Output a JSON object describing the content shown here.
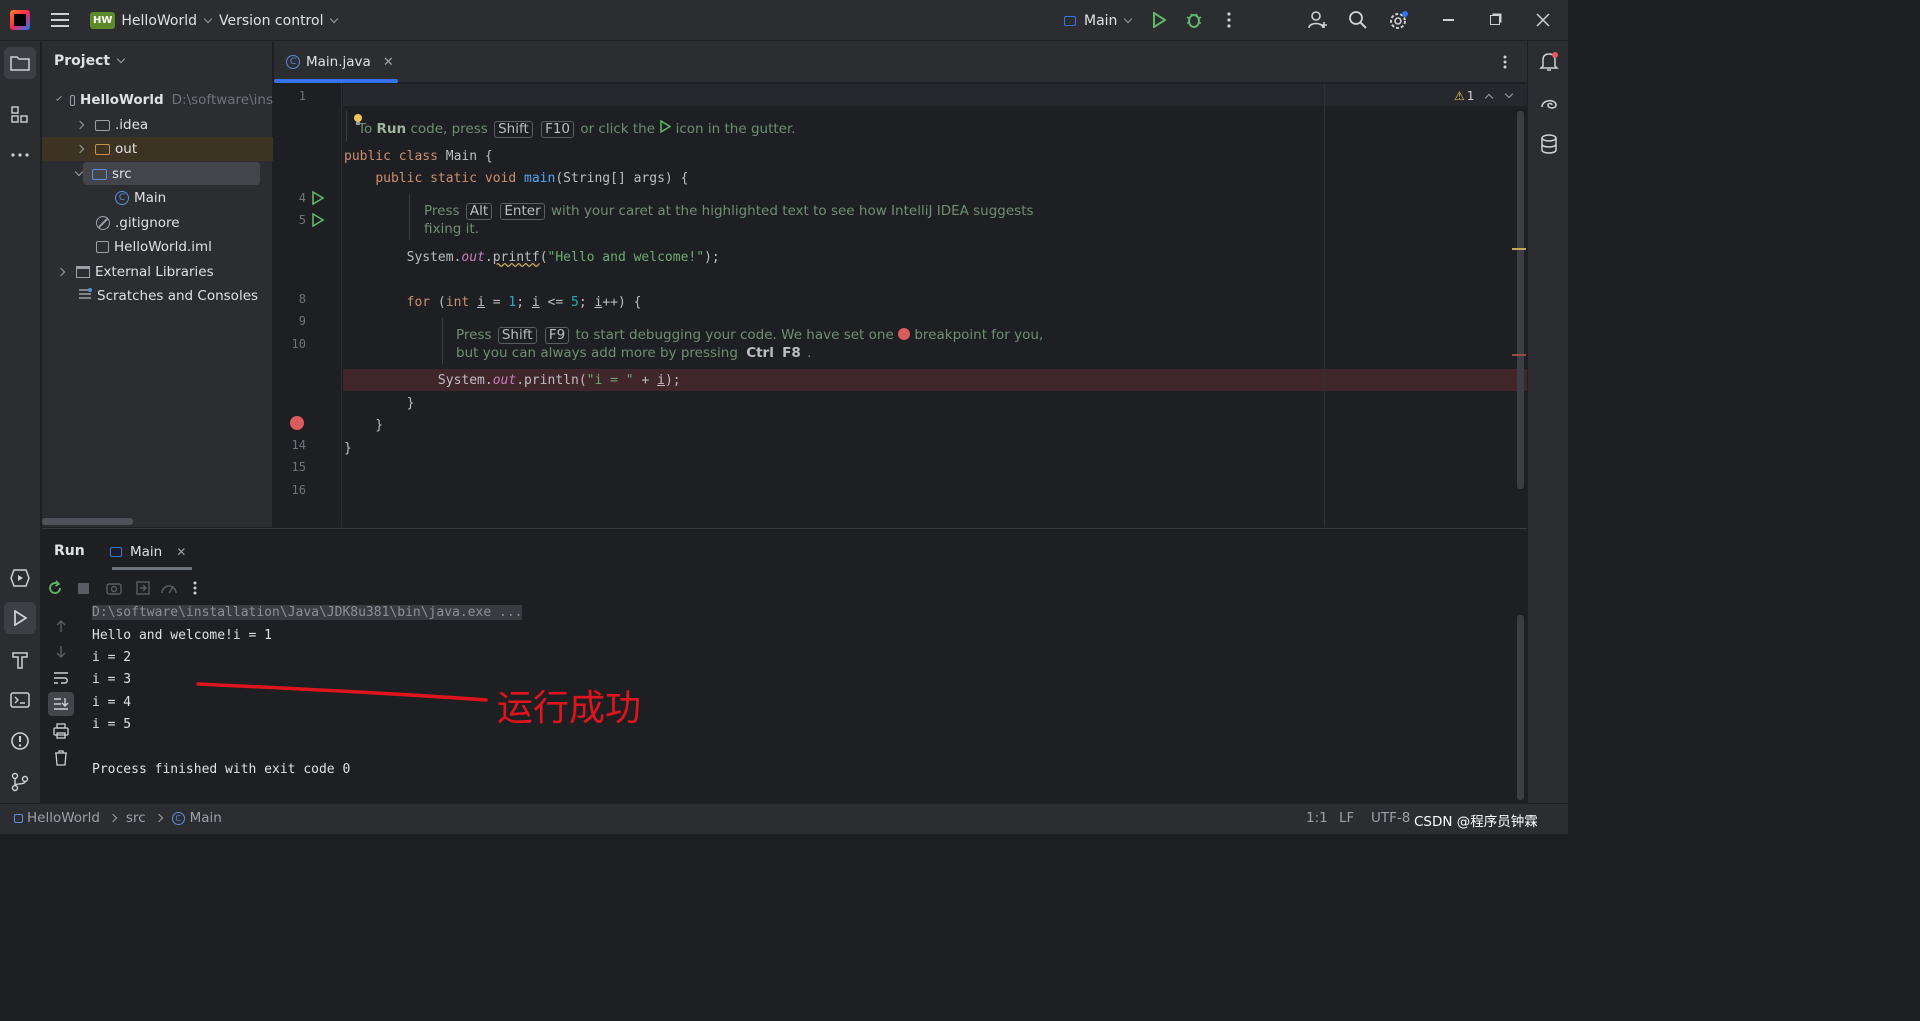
{
  "titlebar": {
    "project_badge": "HW",
    "project_name": "HelloWorld",
    "vcs": "Version control",
    "run_config": "Main"
  },
  "project_panel": {
    "title": "Project",
    "tree": [
      {
        "label": "HelloWorld",
        "path": "D:\\software\\ins"
      },
      {
        "label": ".idea"
      },
      {
        "label": "out"
      },
      {
        "label": "src"
      },
      {
        "label": "Main"
      },
      {
        "label": ".gitignore"
      },
      {
        "label": "HelloWorld.iml"
      },
      {
        "label": "External Libraries"
      },
      {
        "label": "Scratches and Consoles"
      }
    ]
  },
  "editor": {
    "tab": "Main.java",
    "warning_count": "1",
    "line_numbers": [
      "1",
      "4",
      "5",
      "8",
      "9",
      "10",
      "14",
      "15",
      "16"
    ],
    "hint1": {
      "pre": "To",
      "run": "Run",
      "mid": "code, press",
      "key1": "Shift",
      "key2": "F10",
      "post": "or click the",
      "post2": "icon in the gutter."
    },
    "hint2": {
      "pre": "Press",
      "key1": "Alt",
      "key2": "Enter",
      "post": "with your caret at the highlighted text to see how IntelliJ IDEA suggests",
      "line2": "fixing it."
    },
    "hint3": {
      "pre": "Press",
      "key1": "Shift",
      "key2": "F9",
      "post": "to start debugging your code. We have set one",
      "post2": "breakpoint for you,",
      "line2_pre": "but you can always add more by pressing",
      "key3": "Ctrl",
      "key4": "F8",
      "line2_post": "."
    }
  },
  "run_panel": {
    "title": "Run",
    "tab": "Main",
    "output": [
      "D:\\software\\installation\\Java\\JDK8u381\\bin\\java.exe ...",
      "Hello and welcome!i = 1",
      "i = 2",
      "i = 3",
      "i = 4",
      "i = 5",
      "",
      "Process finished with exit code 0"
    ],
    "annotation": "运行成功"
  },
  "statusbar": {
    "crumbs": [
      "HelloWorld",
      "src",
      "Main"
    ],
    "position": "1:1",
    "line_sep": "LF",
    "encoding": "UTF-8",
    "watermark": "CSDN @程序员钟霖"
  },
  "colors": {
    "accent": "#3574f0",
    "run_green": "#4ca14a",
    "breakpoint": "#db5c5c",
    "annotation_red": "#e0141c"
  }
}
